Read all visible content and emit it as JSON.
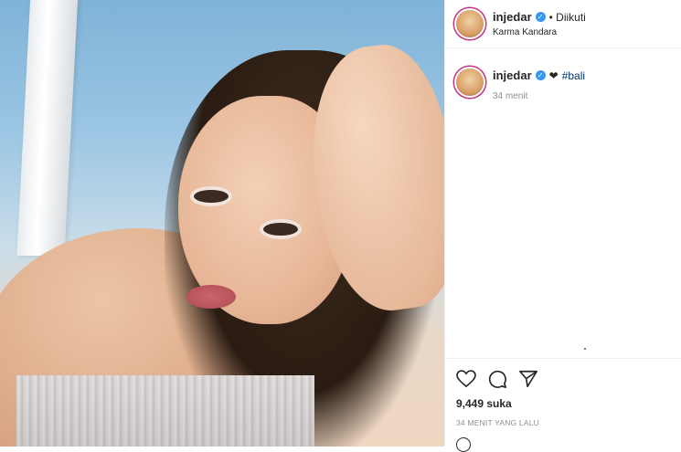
{
  "post": {
    "image_alt_name": "post-photo"
  },
  "header": {
    "username": "injedar",
    "verified_glyph": "✓",
    "follow_status": "• Diikuti",
    "location": "Karma Kandara"
  },
  "caption": {
    "username": "injedar",
    "heart": "❤",
    "hashtag": "#bali",
    "time": "34 menit"
  },
  "actions": {
    "icons": [
      "heart-icon",
      "comment-icon",
      "share-icon"
    ],
    "likes": "9,449 suka",
    "posted_ago": "34 MENIT YANG LALU"
  },
  "colors": {
    "verified": "#3897f0",
    "story_ring": "#c13584",
    "hashtag": "#00376b"
  }
}
